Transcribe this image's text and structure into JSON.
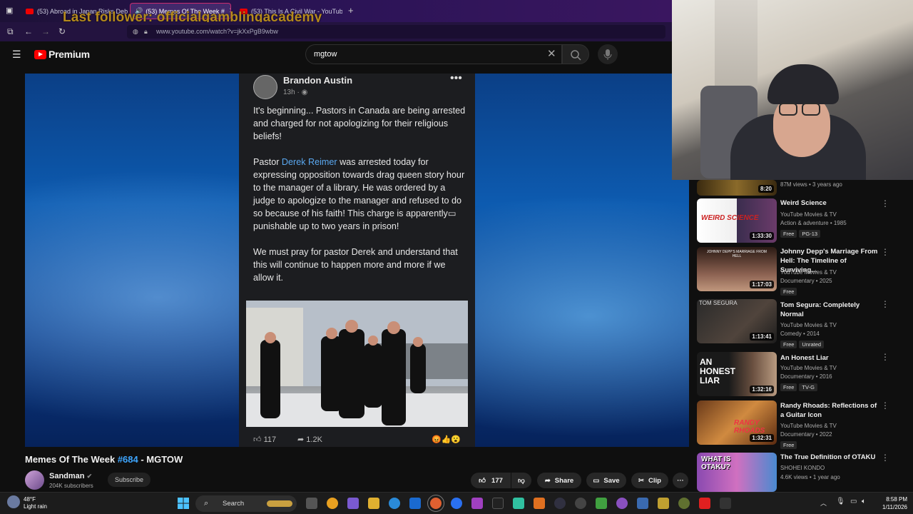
{
  "browser": {
    "tabs": [
      {
        "label": "(53) Abroad in Japan Risks Deb"
      },
      {
        "label": "(53) Memes Of The Week #",
        "active": true
      },
      {
        "label": "(53) This Is A Civil War - YouTub"
      }
    ],
    "new_tab": "+",
    "url": "www.youtube.com/watch?v=jkXxPgB9wbw",
    "overlay_text": "Last follower: officialgamblingacademy"
  },
  "youtube": {
    "logo_text": "Premium",
    "search_value": "mgtow",
    "video": {
      "title_prefix": "Memes Of The Week ",
      "title_number": "#684",
      "title_suffix": " - MGTOW",
      "channel": "Sandman",
      "subscribers": "204K subscribers",
      "subscribe_label": "Subscribe",
      "likes": "177",
      "share_label": "Share",
      "save_label": "Save",
      "clip_label": "Clip"
    },
    "post": {
      "author": "Brandon Austin",
      "time": "13h · ",
      "para1": "It's beginning... Pastors in Canada are being arrested and charged for not apologizing for their religious beliefs!",
      "para2_pre": "Pastor ",
      "para2_link": "Derek Reimer",
      "para2_post": " was arrested today for expressing opposition towards drag queen story hour to the manager of a library. He was ordered by a judge to apologize to the manager and refused to do so because of his faith! This charge is apparently▭ punishable up to two years in prison!",
      "para3": "We must pray for pastor Derek and understand that this will continue to happen more and more if we allow it.",
      "likes": "117",
      "shares": "1.2K"
    },
    "sidebar": [
      {
        "title": "",
        "meta1": "87M views • 3 years ago",
        "meta2": "",
        "duration": "8:20",
        "badges": []
      },
      {
        "title": "Weird Science",
        "meta1": "YouTube Movies & TV",
        "meta2": "Action & adventure • 1985",
        "duration": "1:33:30",
        "badges": [
          "Free",
          "PG-13"
        ],
        "thumb_text": "WEIRD SCIENCE"
      },
      {
        "title": "Johnny Depp's Marriage From Hell: The Timeline of Surviving...",
        "meta1": "YouTube Movies & TV",
        "meta2": "Documentary • 2025",
        "duration": "1:17:03",
        "badges": [
          "Free"
        ],
        "thumb_text": "JOHNNY DEPP'S MARRIAGE FROM HELL"
      },
      {
        "title": "Tom Segura: Completely Normal",
        "meta1": "YouTube Movies & TV",
        "meta2": "Comedy • 2014",
        "duration": "1:13:41",
        "badges": [
          "Free",
          "Unrated"
        ],
        "thumb_text": "TOM SEGURA"
      },
      {
        "title": "An Honest Liar",
        "meta1": "YouTube Movies & TV",
        "meta2": "Documentary • 2016",
        "duration": "1:32:16",
        "badges": [
          "Free",
          "TV-G"
        ],
        "thumb_text": "AN HONEST LIAR"
      },
      {
        "title": "Randy Rhoads: Reflections of a Guitar Icon",
        "meta1": "YouTube Movies & TV",
        "meta2": "Documentary • 2022",
        "duration": "1:32:31",
        "badges": [
          "Free"
        ],
        "thumb_text": "RANDY RHOADS"
      },
      {
        "title": "The True Definition of OTAKU",
        "meta1": "SHOHEI KONDO",
        "meta2": "4.6K views • 1 year ago",
        "duration": "",
        "badges": [],
        "thumb_text": "WHAT IS OTAKU?"
      }
    ]
  },
  "taskbar": {
    "weather_temp": "48°F",
    "weather_desc": "Light rain",
    "search_label": "Search",
    "time": "8:58 PM",
    "date": "1/11/2026"
  }
}
